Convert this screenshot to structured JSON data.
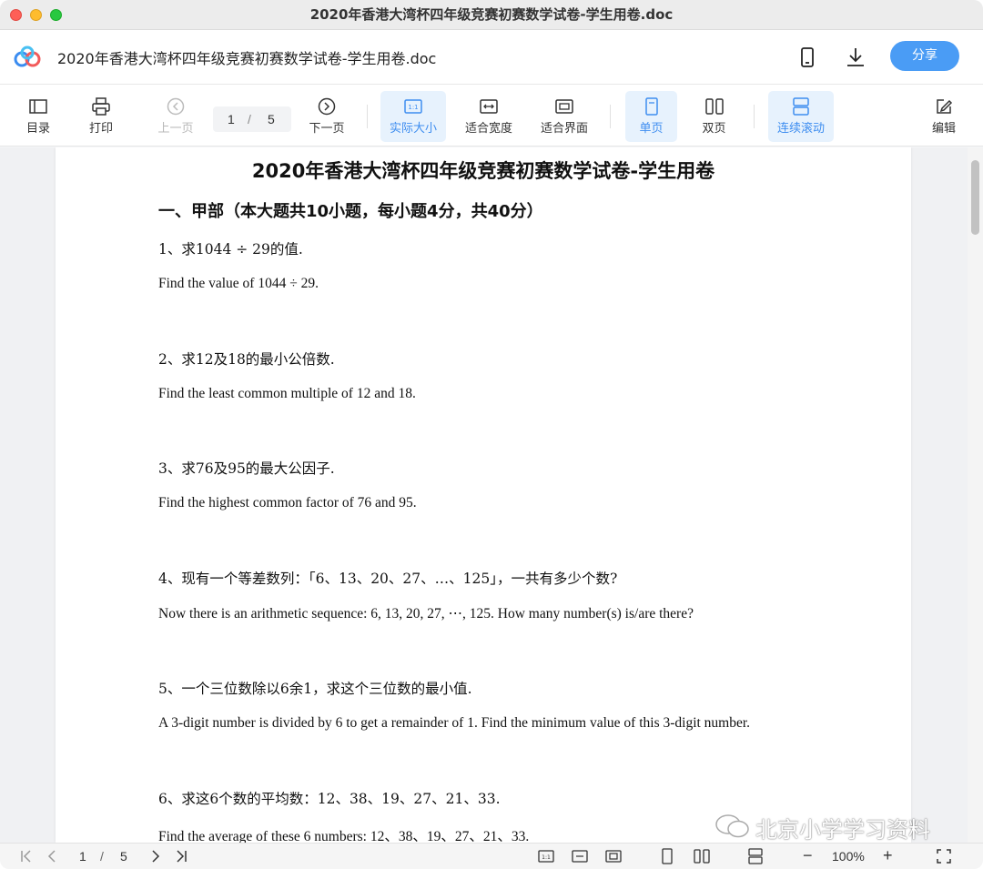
{
  "window": {
    "title": "2020年香港大湾杯四年级竞赛初赛数学试卷-学生用卷.doc"
  },
  "header": {
    "doc_title": "2020年香港大湾杯四年级竞赛初赛数学试卷-学生用卷.doc",
    "share_label": "分享"
  },
  "toolbar": {
    "toc": "目录",
    "print": "打印",
    "prev": "上一页",
    "page_current": "1",
    "page_sep": "/",
    "page_total": "5",
    "next": "下一页",
    "actual_size": "实际大小",
    "fit_width": "适合宽度",
    "fit_window": "适合界面",
    "single_page": "单页",
    "double_page": "双页",
    "continuous": "连续滚动",
    "edit": "编辑"
  },
  "document": {
    "heading": "2020年香港大湾杯四年级竞赛初赛数学试卷-学生用卷",
    "section": "一、甲部（本大题共10小题，每小题4分，共40分）",
    "questions": [
      {
        "cn": "1、求1044 ÷ 29的值.",
        "en": "Find the value of 1044 ÷ 29."
      },
      {
        "cn": "2、求12及18的最小公倍数.",
        "en": "Find the least common multiple of 12 and 18."
      },
      {
        "cn": "3、求76及95的最大公因子.",
        "en": "Find the highest common factor of 76 and 95."
      },
      {
        "cn": "4、现有一个等差数列：「6、13、20、27、…、125」，一共有多少个数?",
        "en": "Now there is an arithmetic sequence: 6, 13, 20, 27, ⋯, 125. How many number(s) is/are there?"
      },
      {
        "cn": "5、一个三位数除以6余1，求这个三位数的最小值.",
        "en": "A 3-digit number is divided by 6 to get a remainder of 1. Find the minimum value of this 3-digit number."
      },
      {
        "cn": "6、求这6个数的平均数：12、38、19、27、21、33.",
        "en": "Find the average of these 6 numbers: 12、38、19、27、21、33."
      }
    ]
  },
  "watermark": "北京小学学习资料",
  "statusbar": {
    "page_current": "1",
    "page_sep": "/",
    "page_total": "5",
    "zoom": "100%",
    "zoom_minus": "−",
    "zoom_plus": "+"
  },
  "colors": {
    "accent": "#3f8ef0",
    "share": "#4a9cf5",
    "active_bg": "#e7f2fd"
  }
}
